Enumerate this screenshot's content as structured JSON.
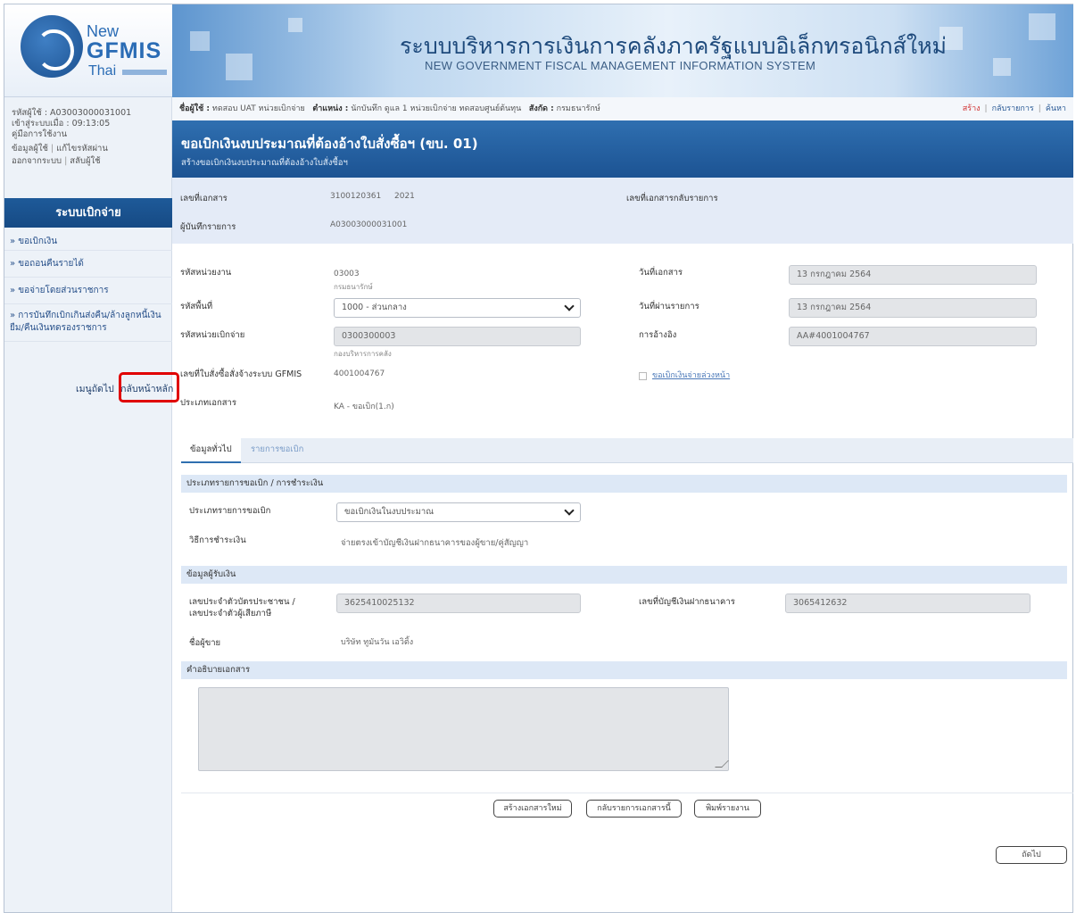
{
  "header": {
    "logo_new": "New",
    "logo_gfmis": "GFMIS",
    "logo_thai": "Thai",
    "title_th": "ระบบบริหารการเงินการคลังภาครัฐแบบอิเล็กทรอนิกส์ใหม่",
    "title_en": "NEW GOVERNMENT FISCAL MANAGEMENT INFORMATION SYSTEM"
  },
  "sidebar": {
    "user_id": "รหัสผู้ใช้ : A03003000031001",
    "login_time": "เข้าสู่ระบบเมื่อ : 09:13:05",
    "manual": "คู่มือการใช้งาน",
    "user_info": "ข้อมูลผู้ใช้",
    "change_password": "แก้ไขรหัสผ่าน",
    "logout": "ออกจากระบบ",
    "switch_user": "สลับผู้ใช้",
    "system_title": "ระบบเบิกจ่าย",
    "menu": [
      "» ขอเบิกเงิน",
      "» ขอถอนคืนรายได้",
      "» ขอจ่ายโดยส่วนราชการ",
      "» การบันทึกเบิกเกินส่งคืน/ล้างลูกหนี้เงินยืม/คืนเงินทดรองราชการ"
    ],
    "quick_menu": "เมนูถัดไป",
    "back_home": "กลับหน้าหลัก"
  },
  "topbar": {
    "user_label": "ชื่อผู้ใช้ :",
    "user_value": "ทดสอบ UAT หน่วยเบิกจ่าย",
    "position_label": "ตำแหน่ง :",
    "position_value": "นักบันทึก ดูแล 1 หน่วยเบิกจ่าย ทดสอบศูนย์ต้นทุน",
    "affiliation_label": "สังกัด :",
    "affiliation_value": "กรมธนารักษ์",
    "link_create": "สร้าง",
    "link_list": "กลับรายการ",
    "link_search": "ค้นหา"
  },
  "title": {
    "main": "ขอเบิกเงินงบประมาณที่ต้องอ้างใบสั่งซื้อฯ (ขบ. 01)",
    "sub": "สร้างขอเบิกเงินงบประมาณที่ต้องอ้างใบสั่งซื้อฯ"
  },
  "doc": {
    "doc_no_label": "เลขที่เอกสาร",
    "doc_no_value": "3100120361",
    "doc_year": "2021",
    "doc_reverse_label": "เลขที่เอกสารกลับรายการ",
    "recorder_label": "ผู้บันทึกรายการ",
    "recorder_value": "A03003000031001"
  },
  "form": {
    "agency_label": "รหัสหน่วยงาน",
    "agency_value": "03003",
    "agency_name": "กรมธนารักษ์",
    "doc_date_label": "วันที่เอกสาร",
    "doc_date_value": "13 กรกฎาคม 2564",
    "area_label": "รหัสพื้นที่",
    "area_value": "1000 - ส่วนกลาง",
    "post_date_label": "วันที่ผ่านรายการ",
    "post_date_value": "13 กรกฎาคม 2564",
    "disburse_unit_label": "รหัสหน่วยเบิกจ่าย",
    "disburse_unit_value": "0300300003",
    "disburse_unit_name": "กองบริหารการคลัง",
    "reference_label": "การอ้างอิง",
    "reference_value": "AA#4001004767",
    "po_label": "เลขที่ใบสั่งซื้อสั่งจ้างระบบ GFMIS",
    "po_value": "4001004767",
    "advance_link": "ขอเบิกเงินจ่ายล่วงหน้า",
    "doc_type_label": "ประเภทเอกสาร",
    "doc_type_value": "KA - ขอเบิก(1.ก)"
  },
  "tabs": {
    "general": "ข้อมูลทั่วไป",
    "items": "รายการขอเบิก"
  },
  "general": {
    "section_payment": "ประเภทรายการขอเบิก / การชำระเงิน",
    "request_type_label": "ประเภทรายการขอเบิก",
    "request_type_value": "ขอเบิกเงินในงบประมาณ",
    "payment_method_label": "วิธีการชำระเงิน",
    "payment_method_value": "จ่ายตรงเข้าบัญชีเงินฝากธนาคารของผู้ขาย/คู่สัญญา",
    "section_payee": "ข้อมูลผู้รับเงิน",
    "id_label_1": "เลขประจำตัวบัตรประชาชน /",
    "id_label_2": "เลขประจำตัวผู้เสียภาษี",
    "id_value": "3625410025132",
    "bank_account_label": "เลขที่บัญชีเงินฝากธนาคาร",
    "bank_account_value": "3065412632",
    "vendor_label": "ชื่อผู้ขาย",
    "vendor_value": "บริษัท ทูมันวัน เอวิติ้ง",
    "section_desc": "คำอธิบายเอกสาร",
    "description_value": ""
  },
  "buttons": {
    "new_doc": "สร้างเอกสารใหม่",
    "back_to_main": "กลับรายการเอกสารนี้",
    "print": "พิมพ์รายงาน",
    "next": "ถัดไป"
  }
}
